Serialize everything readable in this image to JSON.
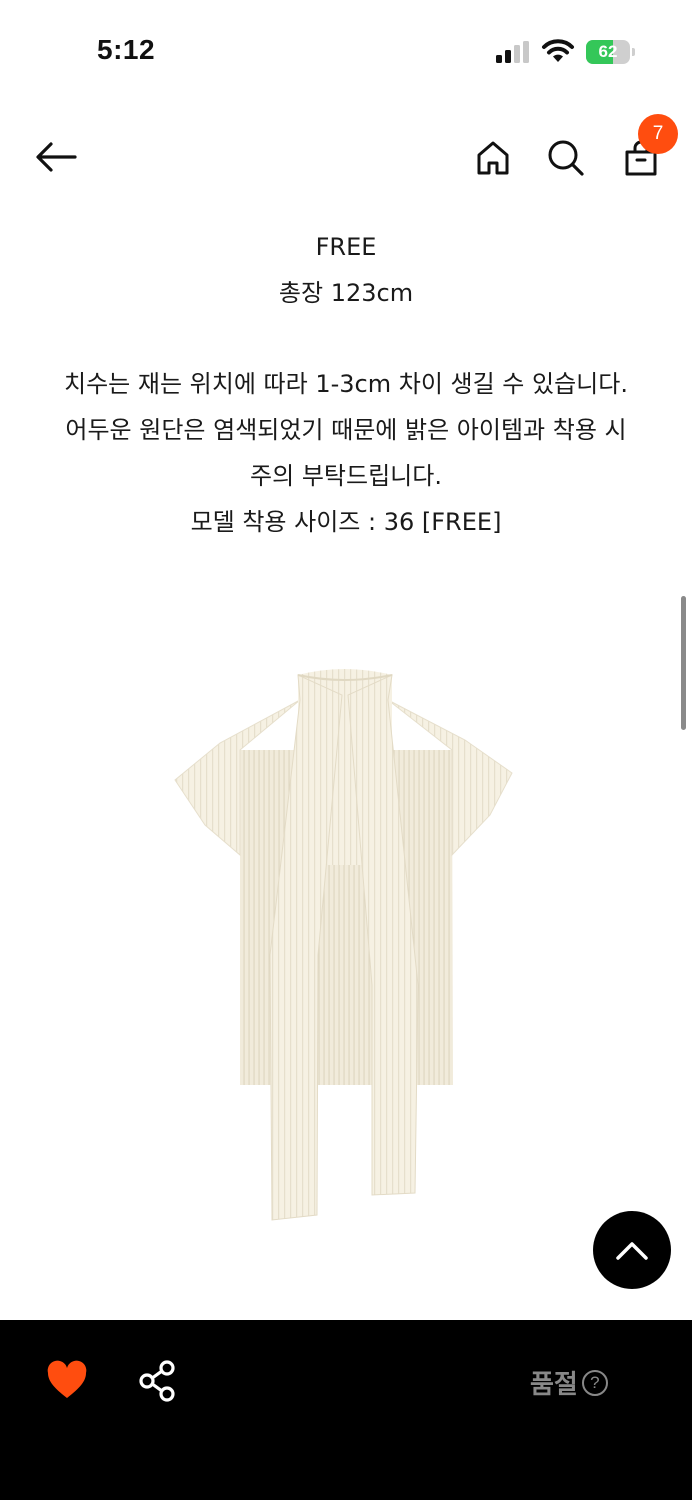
{
  "status_bar": {
    "time": "5:12",
    "battery_level": "62",
    "battery_fraction": 0.62,
    "icons": [
      "cellular-signal-icon",
      "wifi-icon",
      "battery-icon"
    ]
  },
  "nav": {
    "icons": [
      "back-arrow-icon",
      "home-icon",
      "search-icon",
      "shopping-bag-icon"
    ],
    "cart_count": "7"
  },
  "description": {
    "size_label": "FREE",
    "length": "총장 123cm",
    "line1": "치수는 재는 위치에 따라 1-3cm 차이 생길 수 있습니다.",
    "line2": "어두운 원단은 염색되었기 때문에 밝은 아이템과 착용 시",
    "line3": "주의 부탁드립니다.",
    "model_size": "모델 착용 사이즈 : 36 [FREE]"
  },
  "product_image": {
    "subject": "cream pleated sleeveless vest with high collar"
  },
  "bottom_bar": {
    "like_icon": "heart-icon",
    "share_icon": "share-icon",
    "soldout_label": "품절",
    "help_icon": "question-circle-icon",
    "help_glyph": "?"
  },
  "colors": {
    "accent": "#ff4d0f",
    "heart": "#ff4d0f",
    "bottom_bar": "#000000",
    "soldout_text": "#888888",
    "battery": "#34c759"
  }
}
